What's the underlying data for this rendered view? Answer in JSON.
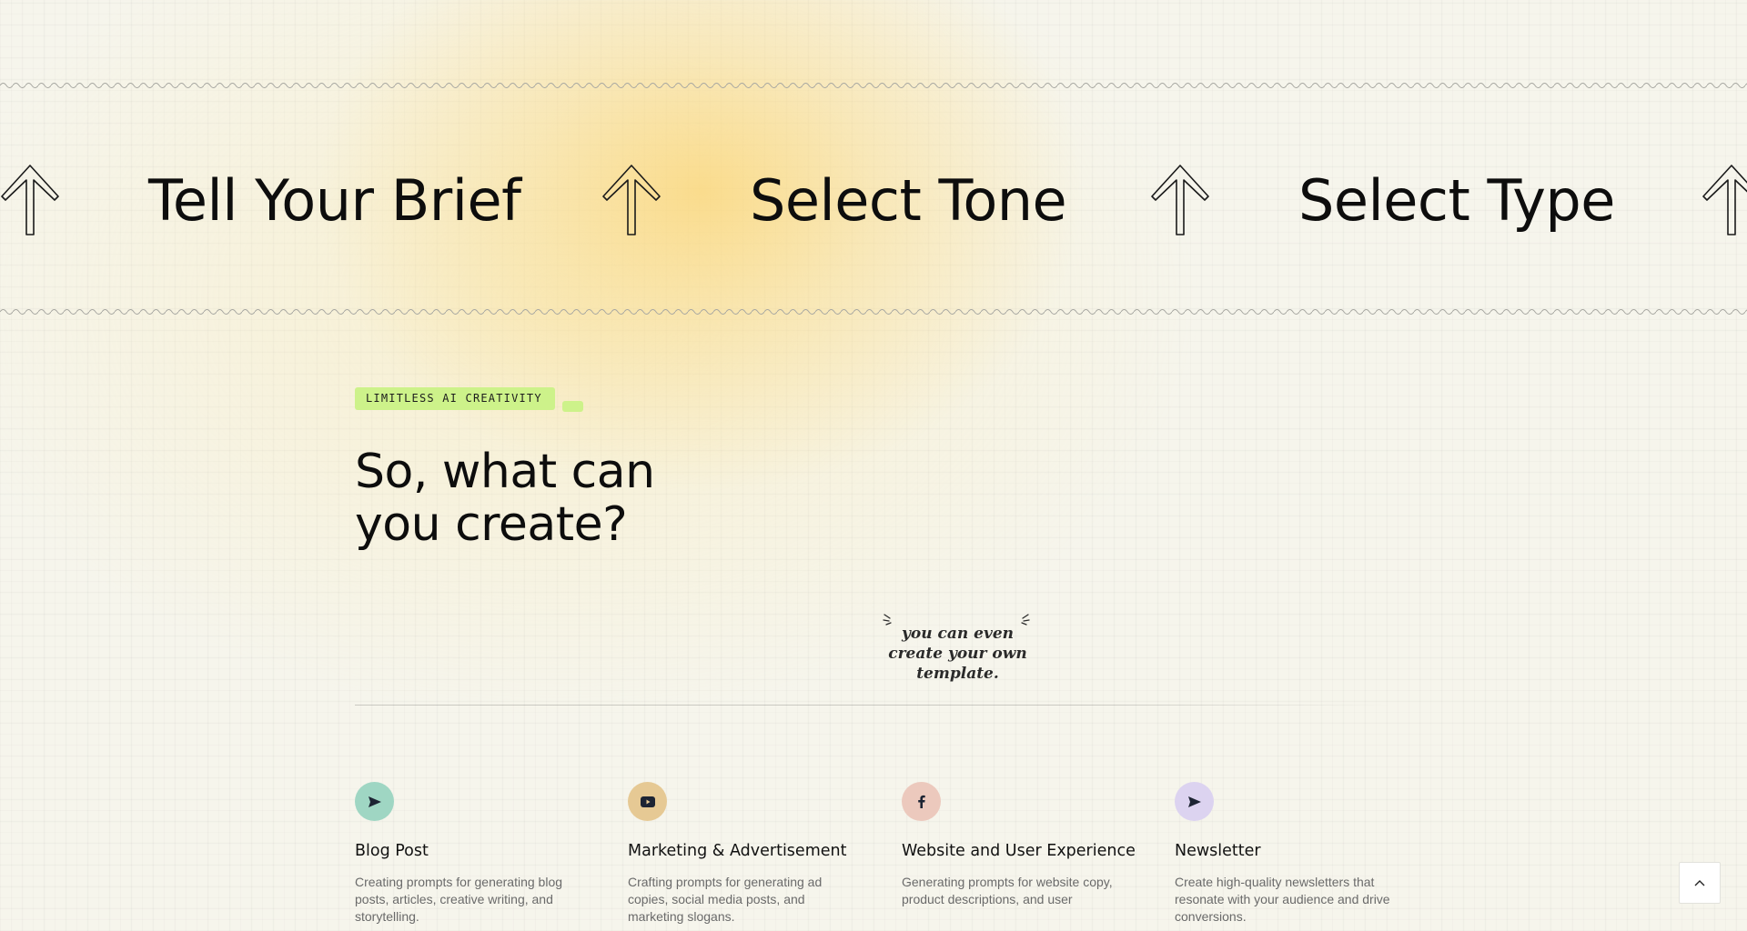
{
  "marquee": {
    "items": [
      "Tell Your Brief",
      "Select Tone",
      "Select Type"
    ]
  },
  "section": {
    "tag": "LIMITLESS AI CREATIVITY",
    "title": "So, what can you create?",
    "note": "you can even create your own template."
  },
  "cards": [
    {
      "title": "Blog Post",
      "description": "Creating prompts for generating blog posts, articles, creative writing, and storytelling.",
      "icon": "send-icon",
      "color": "#9fd6c3"
    },
    {
      "title": "Marketing & Advertisement",
      "description": "Crafting prompts for generating ad copies, social media posts, and marketing slogans.",
      "icon": "youtube-icon",
      "color": "#e6c994"
    },
    {
      "title": "Website and User Experience",
      "description": "Generating prompts for website copy, product descriptions, and user",
      "icon": "facebook-icon",
      "color": "#ecc9bd"
    },
    {
      "title": "Newsletter",
      "description": "Create high-quality newsletters that resonate with your audience and drive conversions.",
      "icon": "send-icon",
      "color": "#dcd3f0"
    }
  ],
  "colors": {
    "background": "#f6f5ec",
    "tag": "#cdf28a",
    "glow": "#fbd678"
  }
}
